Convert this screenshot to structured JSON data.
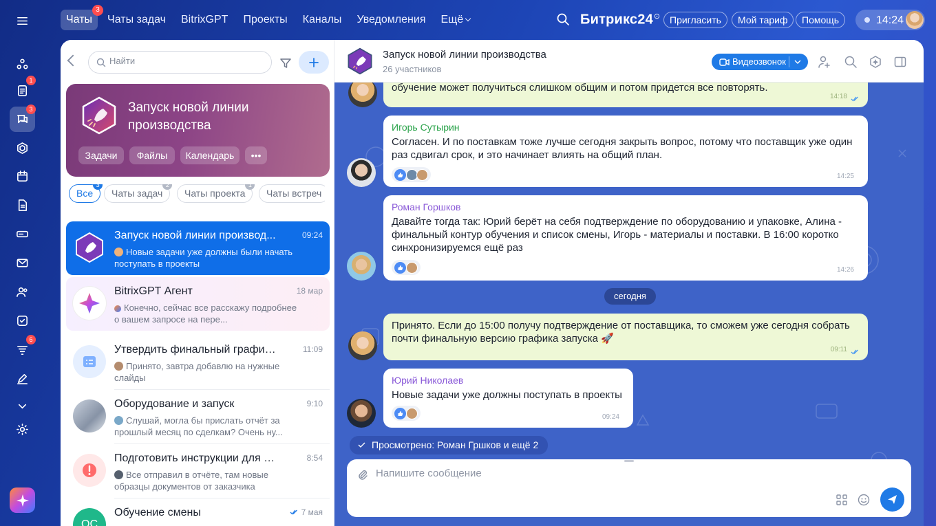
{
  "topnav": {
    "items": [
      {
        "label": "Чаты",
        "badge": "3"
      },
      {
        "label": "Чаты задач"
      },
      {
        "label": "BitrixGPT"
      },
      {
        "label": "Проекты"
      },
      {
        "label": "Каналы"
      },
      {
        "label": "Уведомления"
      },
      {
        "label": "Ещё"
      }
    ],
    "brand": "Битрикс24",
    "invite": "Пригласить",
    "plan": "Мой тариф",
    "help": "Помощь",
    "time": "14:24"
  },
  "rail": {
    "badges": {
      "tasks": "1",
      "chats": "3",
      "feed": "6"
    }
  },
  "chatlist": {
    "search_placeholder": "Найти",
    "card": {
      "title": "Запуск новой линии производства",
      "chips": [
        "Задачи",
        "Файлы",
        "Календарь"
      ]
    },
    "filters": [
      {
        "label": "Все",
        "badge": "3"
      },
      {
        "label": "Чаты задач",
        "badge": "2"
      },
      {
        "label": "Чаты проекта",
        "badge": "1"
      },
      {
        "label": "Чаты встреч"
      }
    ],
    "items": [
      {
        "name": "Запуск новой линии производ...",
        "time": "09:24",
        "preview": "Новые задачи уже должны были начать поступать в проекты"
      },
      {
        "name": "BitrixGPT Агент",
        "time": "18 мар",
        "preview": "Конечно, сейчас все расскажу подробнее о вашем запросе на пере..."
      },
      {
        "name": "Утвердить финальный график по...",
        "time": "11:09",
        "preview": "Принято, завтра добавлю на нужные слайды"
      },
      {
        "name": "Оборудование и запуск",
        "time": "9:10",
        "preview": "Слушай, могла бы прислать отчёт за прошлый месяц по сделкам? Очень ну..."
      },
      {
        "name": "Подготовить инструкции для опе...",
        "time": "8:54",
        "preview": "Все отправил в отчёте, там новые образцы документов от заказчика"
      },
      {
        "name": "Обучение смены",
        "time": "7 мая",
        "preview": "",
        "initials": "ОС"
      }
    ]
  },
  "chat": {
    "title": "Запуск новой линии производства",
    "subtitle": "26 участников",
    "video_label": "Видеозвонок",
    "date_divider": "сегодня",
    "seen": "Просмотрено: Роман Гршков и ещё 2",
    "compose_placeholder": "Напишите сообщение",
    "messages": [
      {
        "text": "обучение может получиться слишком общим и потом придется все повторять.",
        "time": "14:18"
      },
      {
        "author": "Игорь Сутырин",
        "text": "Согласен. И по поставкам тоже лучше сегодня закрыть вопрос, потому что поставщик уже один раз сдвигал срок, и это начинает влиять на общий план.",
        "time": "14:25"
      },
      {
        "author": "Роман Горшков",
        "text": "Давайте тогда так: Юрий берёт на себя подтверждение по оборудованию и упаковке, Алина - финальный контур обучения и список смены, Игорь - материалы и поставки. В 16:00 коротко синхронизируемся ещё раз",
        "time": "14:26"
      },
      {
        "text": "Принято. Если до 15:00 получу подтверждение от поставщика, то сможем уже сегодня собрать почти финальную версию графика запуска 🚀",
        "time": "09:11"
      },
      {
        "author": "Юрий Николаев",
        "text": "Новые задачи уже должны поступать в проекты",
        "time": "09:24"
      }
    ]
  },
  "colors": {
    "accent": "#1f7ae6",
    "chat_bg": "#3e63c8",
    "own_bubble": "#eef8d6"
  }
}
